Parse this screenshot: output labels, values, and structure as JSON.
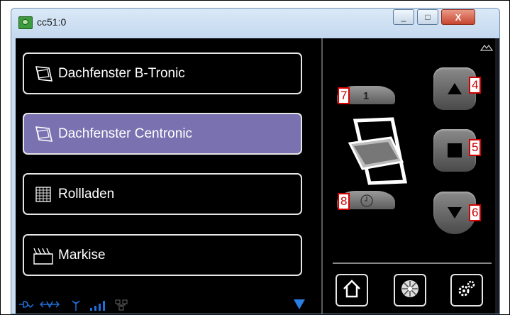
{
  "window": {
    "title": "cc51:0",
    "minimize_glyph": "_",
    "maximize_glyph": "□",
    "close_glyph": "X"
  },
  "devices": [
    {
      "label": "Dachfenster B-Tronic",
      "icon": "roof-window-icon",
      "selected": false
    },
    {
      "label": "Dachfenster Centronic",
      "icon": "roof-window-icon",
      "selected": true
    },
    {
      "label": "Rollladen",
      "icon": "roller-shutter-icon",
      "selected": false
    },
    {
      "label": "Markise",
      "icon": "awning-icon",
      "selected": false
    }
  ],
  "status_icons": [
    "plug-icon",
    "arrows-icon",
    "antenna-icon",
    "signal-bars-icon",
    "network-icon"
  ],
  "control": {
    "channel_value": "1",
    "callouts": {
      "up": "4",
      "stop": "5",
      "down": "6",
      "channel": "7",
      "timer": "8"
    }
  },
  "colors": {
    "selected_bg": "#7a72b0",
    "accent_blue": "#1e6fd9",
    "callout_red": "#d40000"
  }
}
